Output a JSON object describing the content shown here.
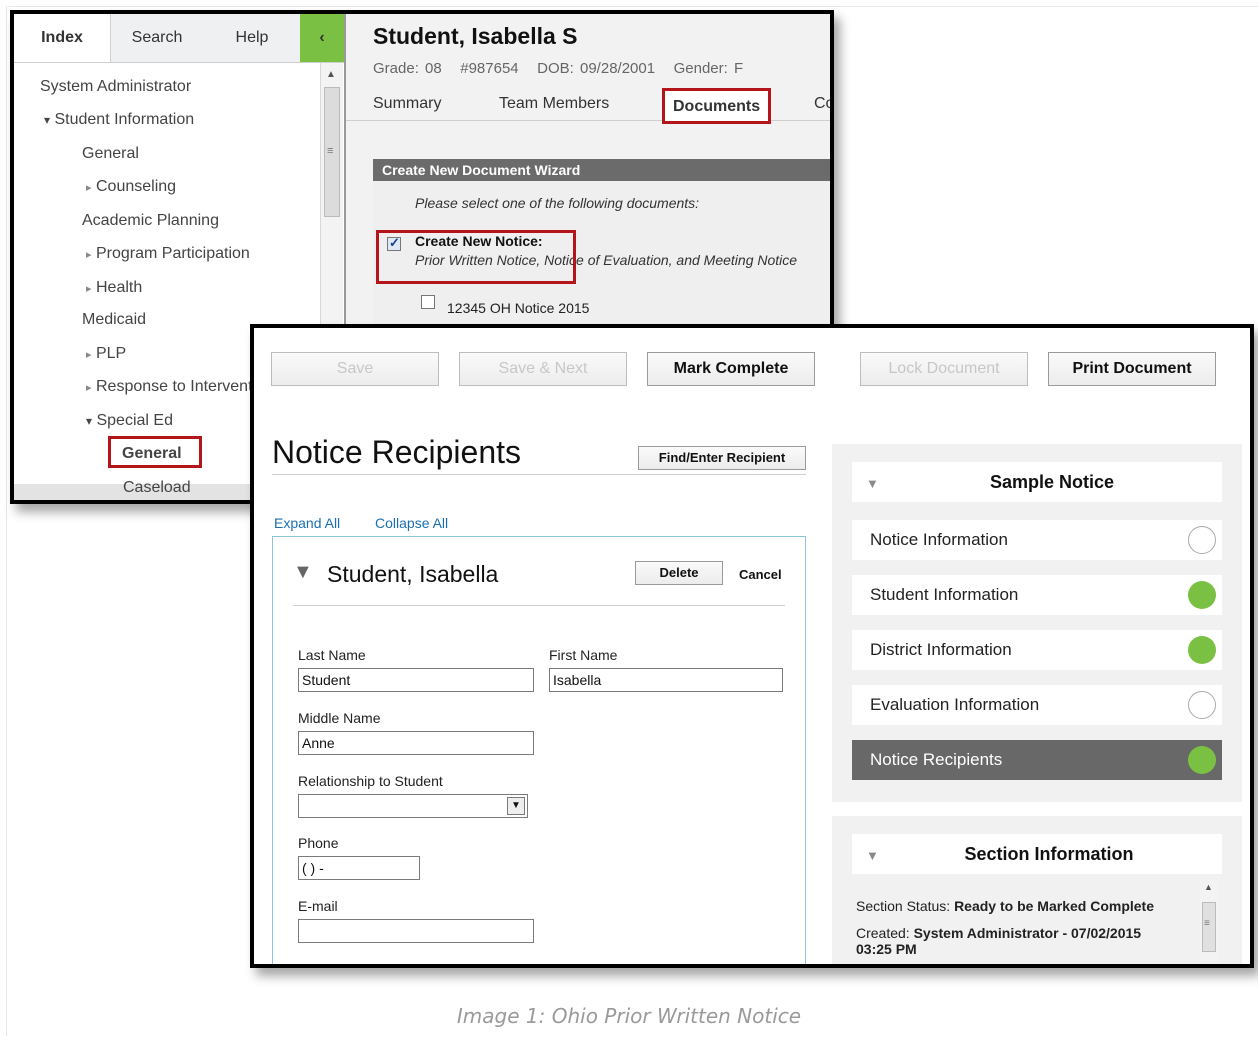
{
  "index_window": {
    "tabs": [
      "Index",
      "Search",
      "Help"
    ],
    "collapse_glyph": "‹",
    "tree": [
      {
        "label": "System Administrator",
        "marker": ""
      },
      {
        "label": "Student Information",
        "marker": "▾"
      },
      {
        "label": "General",
        "marker": ""
      },
      {
        "label": "Counseling",
        "marker": "▸"
      },
      {
        "label": "Academic Planning",
        "marker": ""
      },
      {
        "label": "Program Participation",
        "marker": "▸"
      },
      {
        "label": "Health",
        "marker": "▸"
      },
      {
        "label": "Medicaid",
        "marker": ""
      },
      {
        "label": "PLP",
        "marker": "▸"
      },
      {
        "label": "Response to Intervention",
        "marker": "▸"
      },
      {
        "label": "Special Ed",
        "marker": "▾"
      },
      {
        "label": "General",
        "marker": "",
        "selected": true
      },
      {
        "label": "Caseload",
        "marker": ""
      }
    ]
  },
  "student": {
    "name": "Student, Isabella S",
    "grade": "Grade: 08",
    "id": "#987654",
    "dob": "DOB: 09/28/2001",
    "gender": "Gender: F",
    "tabs": [
      "Summary",
      "Team Members",
      "Documents",
      "Co"
    ],
    "active_tab": "Documents"
  },
  "wizard": {
    "title": "Create New Document Wizard",
    "prompt": "Please select one of the following documents:",
    "option_title": "Create New Notice:",
    "option_desc": "Prior Written Notice, Notice of Evaluation, and Meeting Notice",
    "option_checked": true,
    "sub_option": "12345 OH Notice 2015",
    "sub_option_checked": false
  },
  "toolbar": {
    "save": "Save",
    "save_next": "Save & Next",
    "mark_complete": "Mark Complete",
    "lock_document": "Lock Document",
    "print_document": "Print Document"
  },
  "recipients": {
    "title": "Notice Recipients",
    "find_button": "Find/Enter Recipient",
    "expand_all": "Expand All",
    "collapse_all": "Collapse All",
    "card": {
      "name": "Student, Isabella",
      "delete": "Delete",
      "cancel": "Cancel",
      "last_name_label": "Last Name",
      "last_name_value": "Student",
      "first_name_label": "First Name",
      "first_name_value": "Isabella",
      "middle_name_label": "Middle Name",
      "middle_name_value": "Anne",
      "relationship_label": "Relationship to Student",
      "relationship_value": "",
      "phone_label": "Phone",
      "phone_value": "( )  -",
      "email_label": "E-mail",
      "email_value": ""
    }
  },
  "notice_nav": {
    "title": "Sample Notice",
    "items": [
      {
        "label": "Notice Information",
        "status": "incomplete"
      },
      {
        "label": "Student Information",
        "status": "complete"
      },
      {
        "label": "District Information",
        "status": "complete"
      },
      {
        "label": "Evaluation Information",
        "status": "incomplete"
      },
      {
        "label": "Notice Recipients",
        "status": "complete",
        "active": true
      }
    ],
    "colors": {
      "complete": "#7ac143",
      "active_bg": "#686868"
    }
  },
  "section_info": {
    "title": "Section Information",
    "status_label": "Section Status:",
    "status_value": "Ready to be Marked Complete",
    "created_label": "Created:",
    "created_value": "System Administrator - 07/02/2015",
    "created_time": "03:25 PM"
  },
  "caption": {
    "prefix": "Image 1:",
    "text": "Ohio Prior Written Notice"
  }
}
